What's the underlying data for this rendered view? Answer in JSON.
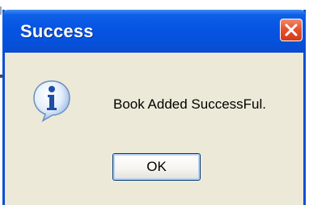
{
  "dialog": {
    "title": "Success",
    "message": "Book Added SuccessFul.",
    "ok_label": "OK",
    "icon": "information-icon",
    "close_icon": "close-icon"
  },
  "colors": {
    "titlebar": "#0654e3",
    "body": "#ece9d8",
    "close_button": "#e5532f"
  }
}
